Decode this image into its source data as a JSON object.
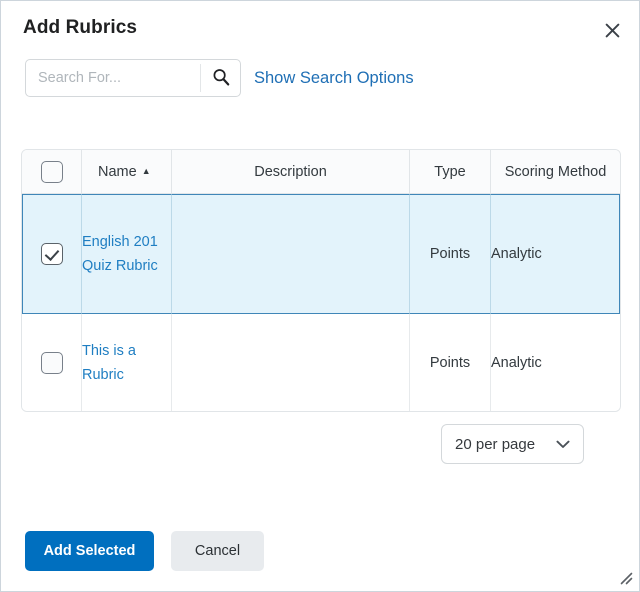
{
  "dialog": {
    "title": "Add Rubrics",
    "close_icon": "close-icon",
    "close_label": "Close"
  },
  "search": {
    "value": "",
    "placeholder": "Search For...",
    "icon": "search-icon",
    "options_link": "Show Search Options"
  },
  "table": {
    "columns": [
      {
        "key": "select",
        "label": ""
      },
      {
        "key": "name",
        "label": "Name",
        "sort": "asc",
        "sort_glyph": "▲"
      },
      {
        "key": "description",
        "label": "Description"
      },
      {
        "key": "type",
        "label": "Type"
      },
      {
        "key": "scoring_method",
        "label": "Scoring Method"
      }
    ],
    "select_all_checked": false,
    "rows": [
      {
        "selected": true,
        "checked": true,
        "name": "English 201 Quiz Rubric",
        "description": "",
        "type": "Points",
        "scoring_method": "Analytic"
      },
      {
        "selected": false,
        "checked": false,
        "name": "This is a Rubric",
        "description": "",
        "type": "Points",
        "scoring_method": "Analytic"
      }
    ]
  },
  "pagination": {
    "per_page_label": "20 per page",
    "chevron_icon": "chevron-down-icon"
  },
  "footer": {
    "primary_label": "Add Selected",
    "secondary_label": "Cancel"
  },
  "resize": {
    "grip_icon": "resize-grip-icon"
  },
  "colors": {
    "accent": "#006fbf",
    "link": "#1f7ec2",
    "selected_row_bg": "#e3f3fb",
    "selected_row_border": "#3f86b8",
    "secondary_button_bg": "#e8ebee"
  }
}
